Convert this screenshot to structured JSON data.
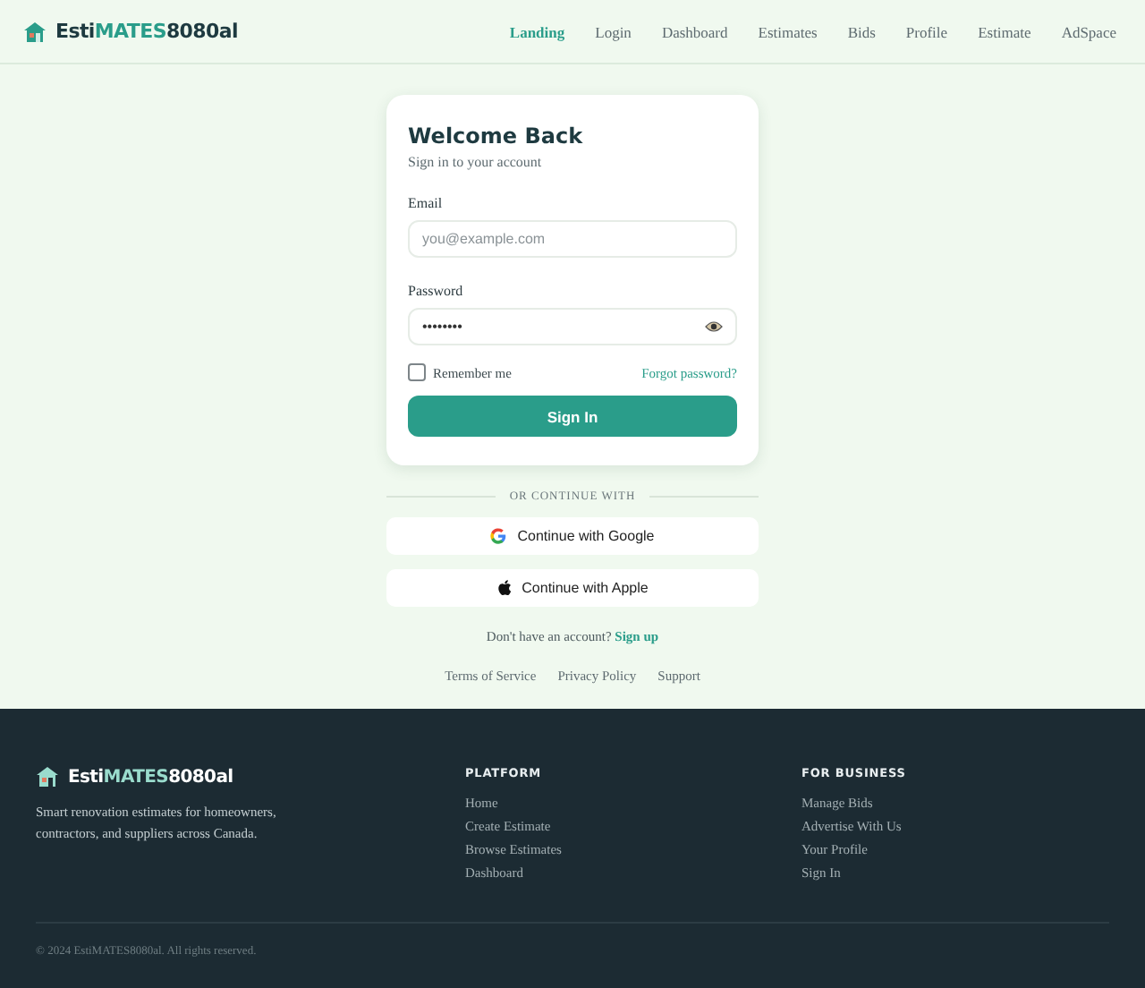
{
  "header": {
    "logo": [
      {
        "text": "Esti",
        "kind": "plain"
      },
      {
        "text": "MATES",
        "kind": "accent"
      },
      {
        "text": "8080al",
        "kind": "plain"
      }
    ],
    "nav": [
      {
        "label": "Landing",
        "selected": true
      },
      {
        "label": "Login",
        "selected": false
      },
      {
        "label": "Dashboard",
        "selected": false
      },
      {
        "label": "Estimates",
        "selected": false
      },
      {
        "label": "Bids",
        "selected": false
      },
      {
        "label": "Profile",
        "selected": false
      },
      {
        "label": "Estimate",
        "selected": false
      },
      {
        "label": "AdSpace",
        "selected": false
      }
    ]
  },
  "login": {
    "title": "Welcome Back",
    "subtitle": "Sign in to your account",
    "email": {
      "label": "Email",
      "placeholder": "you@example.com"
    },
    "password": {
      "label": "Password",
      "value": "••••••••"
    },
    "remember": {
      "label": "Remember me",
      "checked": false
    },
    "forgot": "Forgot password?",
    "submit": "Sign In"
  },
  "divider": "OR CONTINUE WITH",
  "social": [
    {
      "kind": "google",
      "label": "Continue with Google"
    },
    {
      "kind": "apple",
      "label": "Continue with Apple"
    }
  ],
  "signup": {
    "prompt": "Don't have an account?",
    "link": "Sign up"
  },
  "links": [
    "Terms of Service",
    "Privacy Policy",
    "Support"
  ],
  "footer": {
    "logo": [
      {
        "text": "Esti",
        "kind": "plain"
      },
      {
        "text": "MATES",
        "kind": "accent"
      },
      {
        "text": "8080al",
        "kind": "plain"
      }
    ],
    "tagline": "Smart renovation estimates for homeowners, contractors, and suppliers across Canada.",
    "columns": [
      {
        "heading": "PLATFORM",
        "links": [
          "Home",
          "Create Estimate",
          "Browse Estimates",
          "Dashboard"
        ]
      },
      {
        "heading": "FOR BUSINESS",
        "links": [
          "Manage Bids",
          "Advertise With Us",
          "Your Profile",
          "Sign In"
        ]
      }
    ],
    "copyright": "© 2024 EstiMATES8080al. All rights reserved."
  }
}
